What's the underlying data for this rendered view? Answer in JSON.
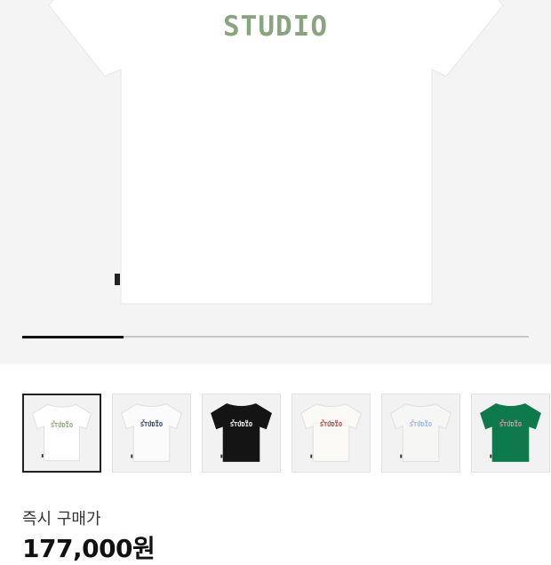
{
  "hero": {
    "print_text": "STUDIO",
    "print_color": "#8aa480",
    "shirt_color": "#ffffff",
    "slide_progress": 0.25
  },
  "thumbnails": [
    {
      "name": "white-green",
      "shirt_color": "#ffffff",
      "print_color": "#8aa480",
      "top_text": "ㅈㅅㅂ",
      "main_text": "STUDIO",
      "selected": true
    },
    {
      "name": "white-navy",
      "shirt_color": "#fbfbfb",
      "print_color": "#2f3f6b",
      "top_text": "ㅈㅅㅂ",
      "main_text": "STUDIO",
      "selected": false
    },
    {
      "name": "black-white",
      "shirt_color": "#141414",
      "print_color": "#ffffff",
      "top_text": "ㅈㅅㅂ",
      "main_text": "STUDIO",
      "selected": false
    },
    {
      "name": "white-red",
      "shirt_color": "#faf9f6",
      "print_color": "#b8413e",
      "top_text": "ㅈㅅㅂ",
      "main_text": "STUDIO",
      "selected": false
    },
    {
      "name": "white-skyblue",
      "shirt_color": "#f6f6f4",
      "print_color": "#9ab8de",
      "top_text": "ㅈㅅㅂ",
      "main_text": "STUDIO",
      "selected": false
    },
    {
      "name": "green-pink",
      "shirt_color": "#0e7a4c",
      "print_color": "#e58fa6",
      "top_text": "ㅈㅅㅂ",
      "main_text": "STUDIO",
      "selected": false
    }
  ],
  "purchase": {
    "label": "즉시 구매가",
    "price": "177,000원"
  }
}
